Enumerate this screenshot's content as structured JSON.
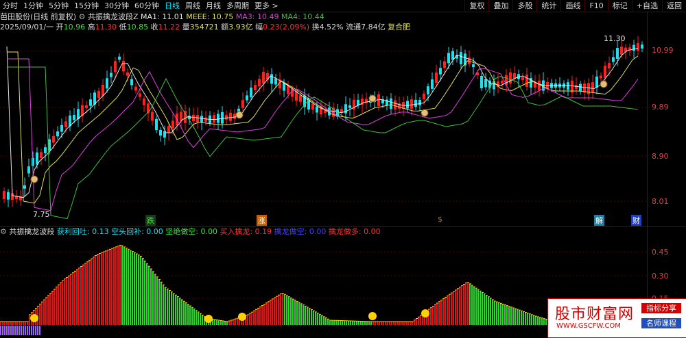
{
  "toolbar": {
    "left": [
      "分时",
      "1分钟",
      "5分钟",
      "15分钟",
      "30分钟",
      "60分钟",
      "日线",
      "周线",
      "月线",
      "多周期",
      "更多 >"
    ],
    "active_index": 6,
    "right": [
      "复权",
      "叠加",
      "多股",
      "统计",
      "画线",
      "F10",
      "标记",
      "+自选",
      "返回"
    ]
  },
  "info1": {
    "stock": "芭田股份(日线 前复权)",
    "indicator": "共振擒龙波段Z",
    "ma1": "MA1: 11.01",
    "meee": "MEEE: 10.75",
    "ma3": "MA3: 10.49",
    "ma4": "MA4: 10.44"
  },
  "info2": {
    "date": "2025/09/01/一",
    "open_label": "开",
    "open": "10.96",
    "high_label": "高",
    "high": "11.30",
    "low_label": "低",
    "low": "10.85",
    "close_label": "收",
    "close": "11.22",
    "vol_label": "量",
    "vol": "354721",
    "amt_label": "额",
    "amt": "3.93亿",
    "chg_label": "幅",
    "chg": "0.23(2.09%)",
    "turnover": "换4.52%",
    "float": "流通7.84亿",
    "fuquan": "复合肥"
  },
  "info3": {
    "name": "共振擒龙波段",
    "a": "获利回吐: 0.13",
    "b": "空头回补: 0.00",
    "c": "坚绝做空: 0.00",
    "d": "买入擒龙: 0.19",
    "e": "擒龙做空: 0.00",
    "f": "擒龙做多: 0.00"
  },
  "y_axis": [
    "10.99",
    "9.89",
    "8.90",
    "8.01"
  ],
  "sub_axis": [
    "0.45",
    "0.30",
    "0.15"
  ],
  "annotations": {
    "high": "11.30",
    "low": "7.75"
  },
  "events": [
    "跌",
    "涨",
    "$",
    "解",
    "财"
  ],
  "ad": {
    "title": "股市财富网",
    "url": "WWW.GSCFW.COM",
    "tag1": "指标分享",
    "tag2": "名师课程"
  },
  "colors": {
    "up": "#ff2020",
    "down": "#20e0f0",
    "ma_white": "#e8e8e8",
    "ma_yellow": "#e0e060",
    "ma_magenta": "#e040e0",
    "ma_green": "#40c040"
  }
}
